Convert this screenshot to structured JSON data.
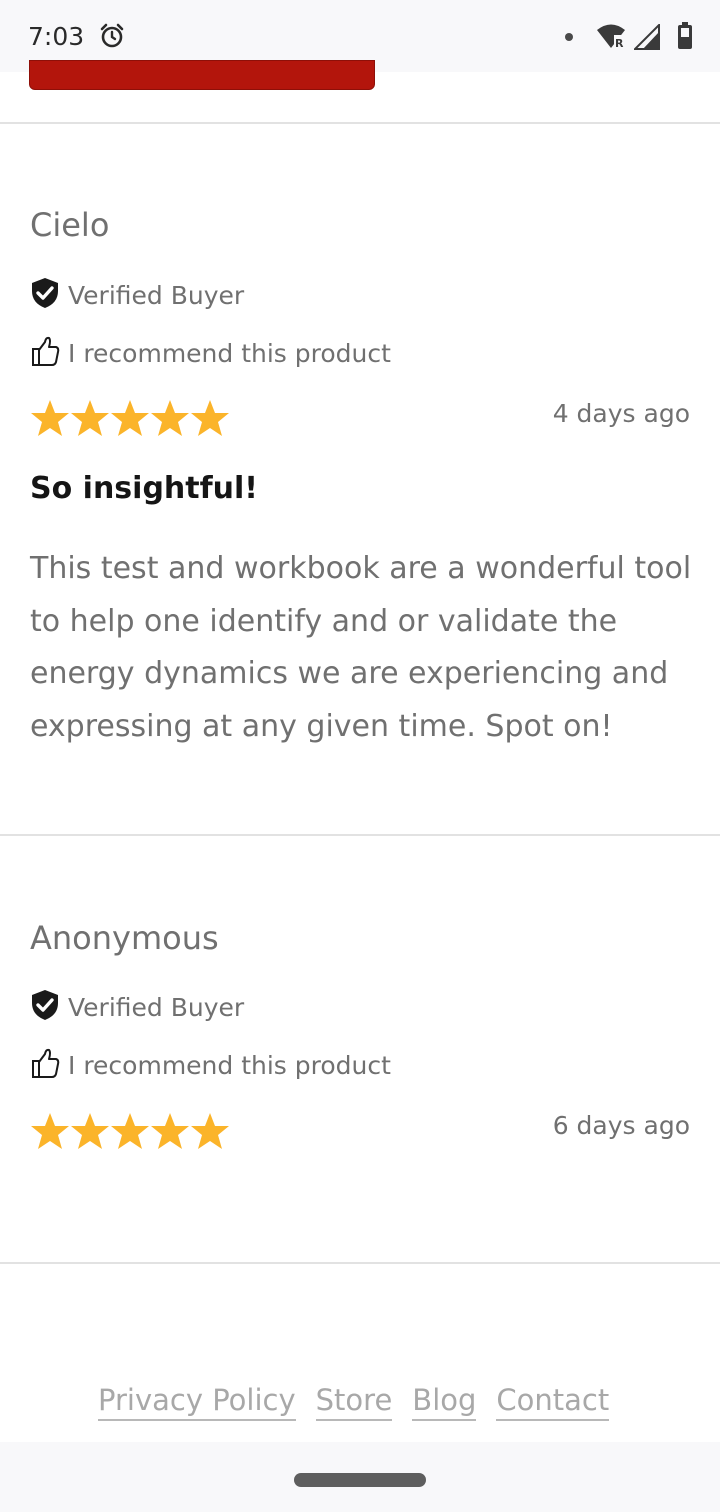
{
  "status_bar": {
    "time": "7:03",
    "icons": [
      "alarm-icon",
      "notification-dot-icon",
      "wifi-icon",
      "signal-icon",
      "battery-icon"
    ]
  },
  "reviews": [
    {
      "name": "Cielo",
      "verified_label": "Verified Buyer",
      "recommend_label": "I recommend this product",
      "rating": 5,
      "date": "4 days ago",
      "title": "So insightful!",
      "body": "This test and workbook are a wonderful tool to help one identify and or validate the energy dynamics we are experiencing and expressing at any given time. Spot on!"
    },
    {
      "name": "Anonymous",
      "verified_label": "Verified Buyer",
      "recommend_label": "I recommend this product",
      "rating": 5,
      "date": "6 days ago"
    }
  ],
  "footer": {
    "links": [
      "Privacy Policy",
      "Store",
      "Blog",
      "Contact"
    ]
  },
  "colors": {
    "accent_red": "#b3150c",
    "star": "#fbb42a",
    "text_muted": "#707070"
  }
}
